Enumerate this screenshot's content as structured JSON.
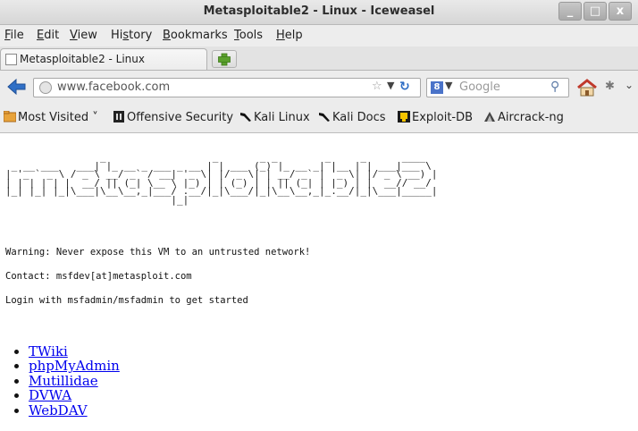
{
  "window": {
    "title": "Metasploitable2 - Linux - Iceweasel",
    "controls": {
      "minimize": "_",
      "maximize": "□",
      "close": "x"
    }
  },
  "menu": [
    "File",
    "Edit",
    "View",
    "History",
    "Bookmarks",
    "Tools",
    "Help"
  ],
  "menu_mnemonics": [
    "F",
    "E",
    "V",
    "s",
    "B",
    "T",
    "H"
  ],
  "tab": {
    "label": "Metasploitable2 - Linux",
    "new_tab_glyph": "+"
  },
  "nav": {
    "url": "www.facebook.com",
    "search_placeholder": "Google",
    "search_engine_glyph": "8",
    "icons": {
      "back": "back-arrow-icon",
      "home": "home-icon",
      "reload": "reload-icon",
      "search": "magnifier-icon"
    }
  },
  "bookmarks": [
    {
      "label": "Most Visited",
      "icon": "most-visited-icon",
      "has_dropdown": true
    },
    {
      "label": "Offensive Security",
      "icon": "offensive-security-icon"
    },
    {
      "label": "Kali Linux",
      "icon": "kali-dragon-icon"
    },
    {
      "label": "Kali Docs",
      "icon": "kali-dragon-icon"
    },
    {
      "label": "Exploit-DB",
      "icon": "exploit-db-icon"
    },
    {
      "label": "Aircrack-ng",
      "icon": "aircrack-icon"
    }
  ],
  "page": {
    "banner_ascii": "                _                  _       _ _        _     _      ____  \n _ __ ___   ___| |_ __ _ ___ _ __ | | ___ (_) |_ __ _| |__ | | ___|___ \\ \n| '_ ` _ \\ / _ \\ __/ _` / __| '_ \\| |/ _ \\| | __/ _` | '_ \\| |/ _ \\ __) |\n| | | | | |  __/ || (_| \\__ \\ |_) | | (_) | | || (_| | |_) | |  __// __/ \n|_| |_| |_|\\___|\\__\\__,_|___/ .__/|_|\\___/|_|\\__\\__,_|_.__/|_|\\___|_____|\n                            |_|                                          ",
    "warning": "Warning: Never expose this VM to an untrusted network!",
    "contact": "Contact: msfdev[at]metasploit.com",
    "login": "Login with msfadmin/msfadmin to get started",
    "links": [
      "TWiki",
      "phpMyAdmin",
      "Mutillidae",
      "DVWA",
      "WebDAV"
    ]
  }
}
